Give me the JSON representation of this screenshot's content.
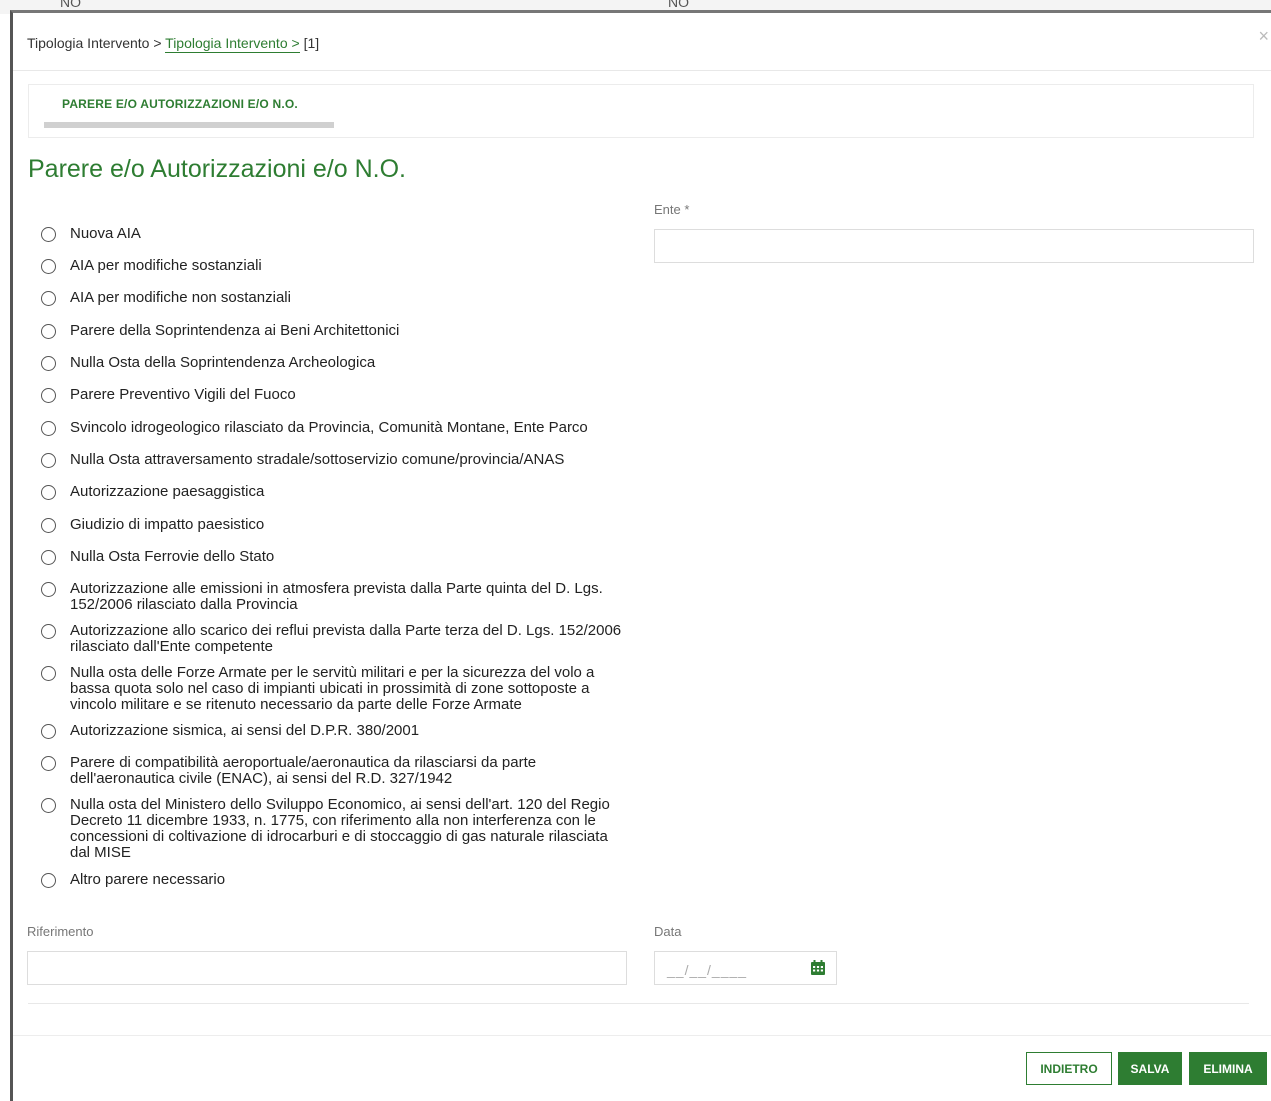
{
  "background": {
    "no_left": "NO",
    "no_right": "NO"
  },
  "breadcrumb": {
    "root": "Tipologia Intervento >",
    "link": "Tipologia Intervento >",
    "current": "[1]"
  },
  "close_glyph": "×",
  "tab": {
    "label": "PARERE E/O AUTORIZZAZIONI E/O N.O."
  },
  "title": "Parere e/o Autorizzazioni e/o N.O.",
  "options": [
    "Nuova AIA",
    "AIA per modifiche sostanziali",
    "AIA per modifiche non sostanziali",
    "Parere della Soprintendenza ai Beni Architettonici",
    "Nulla Osta della Soprintendenza Archeologica",
    "Parere Preventivo Vigili del Fuoco",
    "Svincolo idrogeologico rilasciato da Provincia, Comunità Montane, Ente Parco",
    "Nulla Osta attraversamento stradale/sottoservizio comune/provincia/ANAS",
    "Autorizzazione paesaggistica",
    "Giudizio di impatto paesistico",
    "Nulla Osta Ferrovie dello Stato",
    "Autorizzazione alle emissioni in atmosfera prevista dalla Parte quinta del D. Lgs. 152/2006 rilasciato dalla Provincia",
    "Autorizzazione allo scarico dei reflui prevista dalla Parte terza del D. Lgs. 152/2006 rilasciato dall'Ente competente",
    "Nulla osta delle Forze Armate per le servitù militari e per la sicurezza del volo a bassa quota solo nel caso di impianti ubicati in prossimità di zone sottoposte a vincolo militare e se ritenuto necessario da parte delle Forze Armate",
    "Autorizzazione sismica, ai sensi del D.P.R. 380/2001",
    "Parere di compatibilità aeroportuale/aeronautica da rilasciarsi da parte dell'aeronautica civile (ENAC), ai sensi del R.D. 327/1942",
    "Nulla osta del Ministero dello Sviluppo Economico, ai sensi dell'art. 120 del Regio Decreto 11 dicembre 1933, n. 1775, con riferimento alla non interferenza con le concessioni di coltivazione di idrocarburi e di stoccaggio di gas naturale rilasciata dal MISE",
    "Altro parere necessario"
  ],
  "ente": {
    "label": "Ente *",
    "value": ""
  },
  "riferimento": {
    "label": "Riferimento",
    "value": ""
  },
  "data": {
    "label": "Data",
    "placeholder": "__/__/____"
  },
  "buttons": {
    "back": "INDIETRO",
    "save": "SALVA",
    "delete": "ELIMINA"
  },
  "colors": {
    "accent": "#2e7d32"
  }
}
